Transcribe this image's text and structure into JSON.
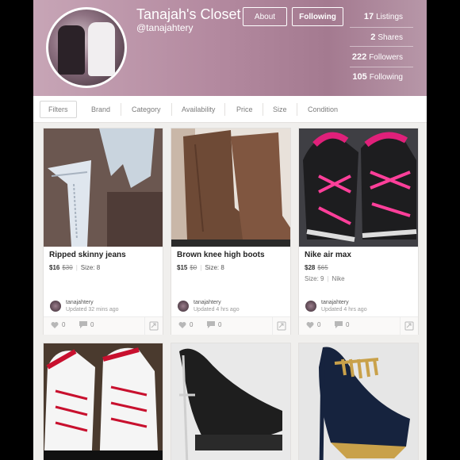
{
  "profile": {
    "title": "Tanajah's Closet",
    "handle": "@tanajahtery",
    "about_label": "About",
    "following_label": "Following"
  },
  "stats": [
    {
      "count": "17",
      "label": "Listings"
    },
    {
      "count": "2",
      "label": "Shares"
    },
    {
      "count": "222",
      "label": "Followers"
    },
    {
      "count": "105",
      "label": "Following"
    }
  ],
  "filters": [
    "Filters",
    "Brand",
    "Category",
    "Availability",
    "Price",
    "Size",
    "Condition"
  ],
  "listings": [
    {
      "title": "Ripped skinny jeans",
      "price": "$16",
      "original": "$30",
      "size": "Size: 8",
      "brand": "",
      "user": "tanajahtery",
      "updated": "Updated 32 mins ago",
      "likes": "0",
      "comments": "0"
    },
    {
      "title": "Brown knee high boots",
      "price": "$15",
      "original": "$0",
      "size": "Size: 8",
      "brand": "",
      "user": "tanajahtery",
      "updated": "Updated 4 hrs ago",
      "likes": "0",
      "comments": "0"
    },
    {
      "title": "Nike air max",
      "price": "$28",
      "original": "$65",
      "size": "Size: 9",
      "brand": "Nike",
      "user": "tanajahtery",
      "updated": "Updated 4 hrs ago",
      "likes": "0",
      "comments": "0"
    }
  ],
  "icons": {
    "like": "heart-icon",
    "comment": "comment-icon",
    "share": "share-icon"
  },
  "colors": {
    "header": "#b48aa0",
    "accent_pink": "#e0207a"
  }
}
